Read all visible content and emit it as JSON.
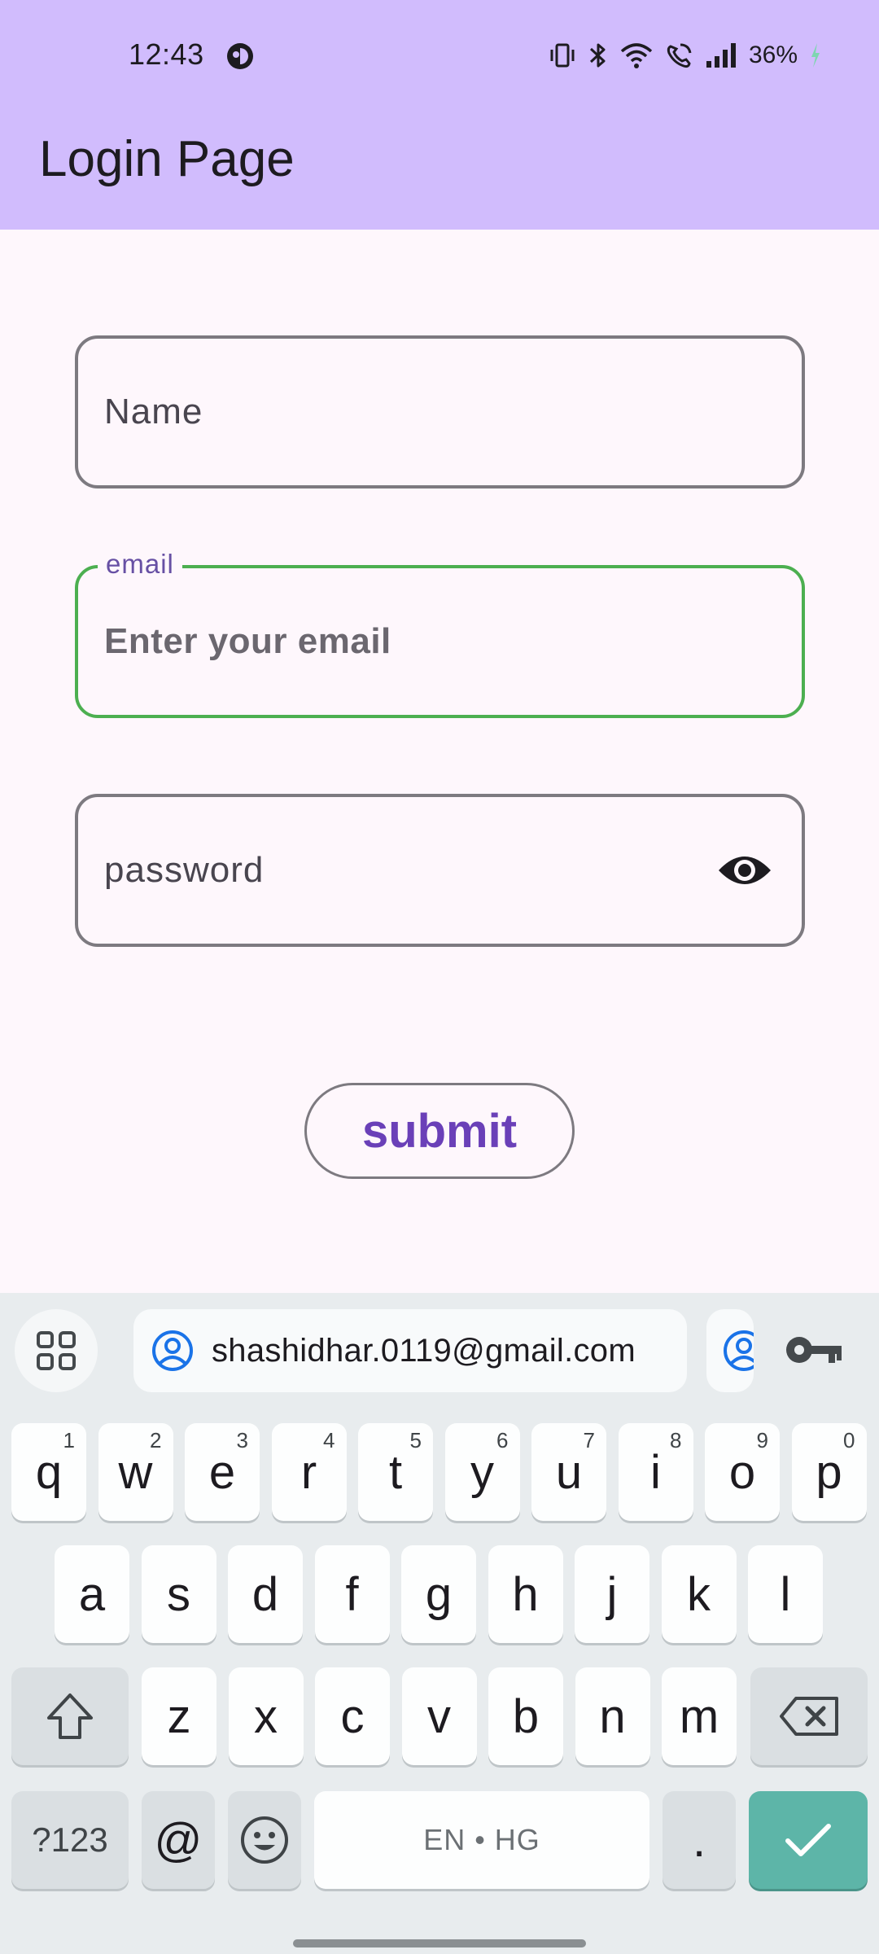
{
  "status_bar": {
    "time": "12:43",
    "battery": "36%",
    "icons": [
      "vibrate-icon",
      "bluetooth-icon",
      "wifi-icon",
      "wifi-calling-icon",
      "signal-icon",
      "battery-charging-icon"
    ]
  },
  "app_bar": {
    "title": "Login Page"
  },
  "form": {
    "name_field": {
      "placeholder": "Name",
      "value": ""
    },
    "email_field": {
      "label": "email",
      "placeholder": "Enter your email",
      "value": "",
      "focused": true
    },
    "password_field": {
      "placeholder": "password",
      "value": "",
      "toggle_icon": "eye-icon"
    },
    "submit_label": "submit"
  },
  "colors": {
    "app_bar_bg": "#d1bcfd",
    "focus_border": "#4caf50",
    "primary": "#6750a4",
    "enter_key": "#5db5a8"
  },
  "keyboard": {
    "suggestion": "shashidhar.0119@gmail.com",
    "row1": [
      {
        "k": "q",
        "n": "1"
      },
      {
        "k": "w",
        "n": "2"
      },
      {
        "k": "e",
        "n": "3"
      },
      {
        "k": "r",
        "n": "4"
      },
      {
        "k": "t",
        "n": "5"
      },
      {
        "k": "y",
        "n": "6"
      },
      {
        "k": "u",
        "n": "7"
      },
      {
        "k": "i",
        "n": "8"
      },
      {
        "k": "o",
        "n": "9"
      },
      {
        "k": "p",
        "n": "0"
      }
    ],
    "row2": [
      "a",
      "s",
      "d",
      "f",
      "g",
      "h",
      "j",
      "k",
      "l"
    ],
    "row3": [
      "z",
      "x",
      "c",
      "v",
      "b",
      "n",
      "m"
    ],
    "symbols_label": "?123",
    "at_label": "@",
    "space_label": "EN • HG",
    "period_label": "."
  }
}
